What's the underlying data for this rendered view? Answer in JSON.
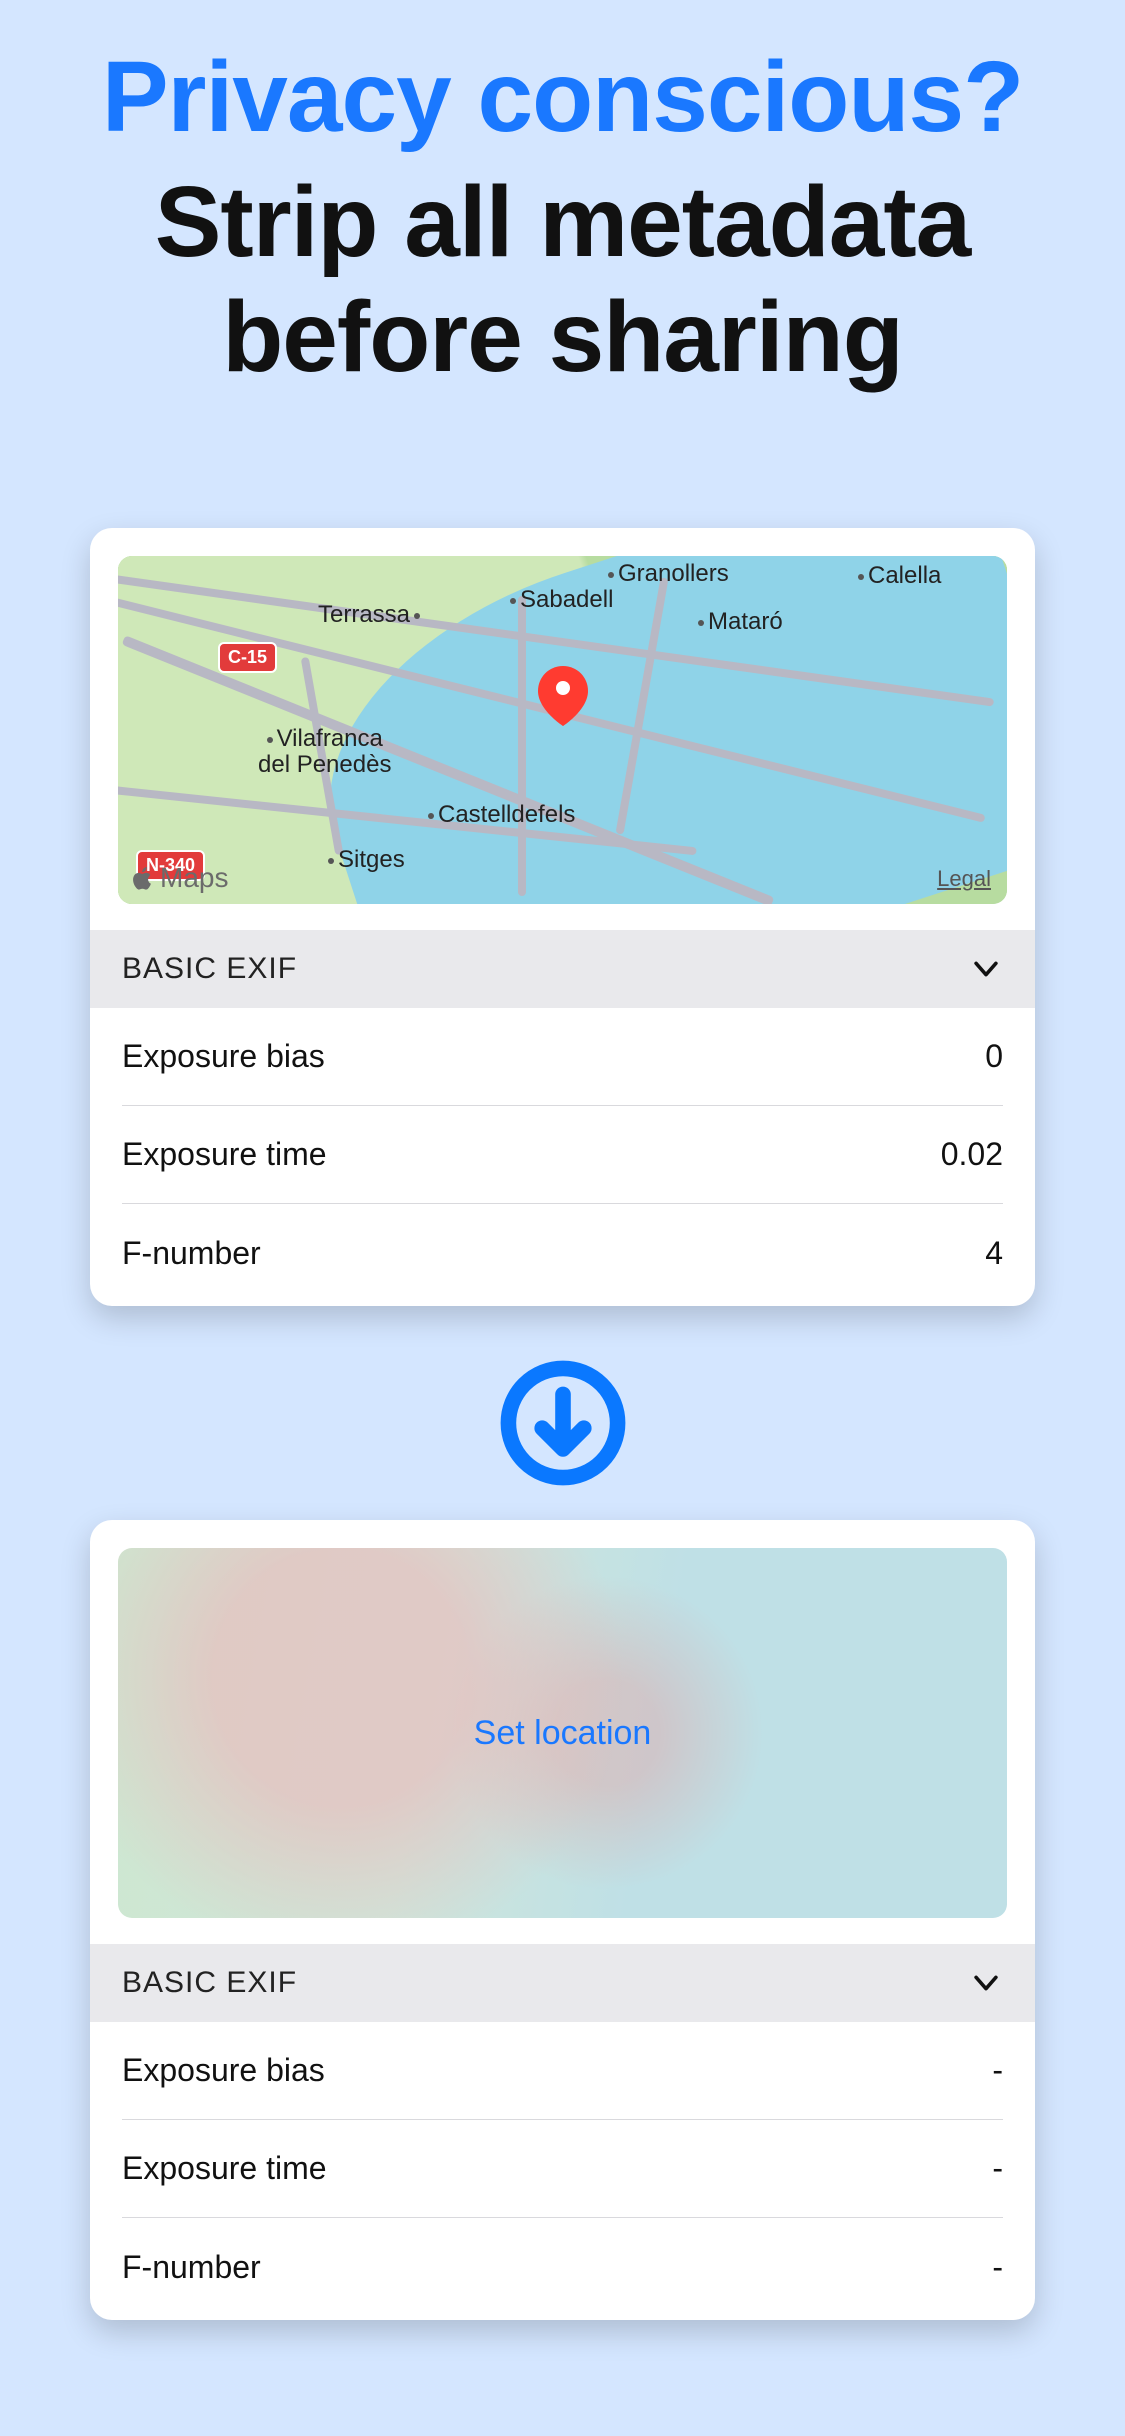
{
  "headline": {
    "line1": "Privacy conscious?",
    "line2": "Strip all metadata before sharing"
  },
  "map": {
    "cities": {
      "terrassa": "Terrassa",
      "sabadell": "Sabadell",
      "granollers": "Granollers",
      "calella": "Calella",
      "mataro": "Mataró",
      "vilafranca1": "Vilafranca",
      "vilafranca2": "del Penedès",
      "castelldefels": "Castelldefels",
      "sitges": "Sitges"
    },
    "shields": {
      "c15": "C-15",
      "n340": "N-340"
    },
    "attribution": "Maps",
    "legal": "Legal"
  },
  "before": {
    "section_title": "BASIC EXIF",
    "rows": [
      {
        "label": "Exposure bias",
        "value": "0"
      },
      {
        "label": "Exposure time",
        "value": "0.02"
      },
      {
        "label": "F-number",
        "value": "4"
      }
    ]
  },
  "after": {
    "set_location": "Set location",
    "section_title": "BASIC EXIF",
    "rows": [
      {
        "label": "Exposure bias",
        "value": "-"
      },
      {
        "label": "Exposure time",
        "value": "-"
      },
      {
        "label": "F-number",
        "value": "-"
      }
    ]
  }
}
